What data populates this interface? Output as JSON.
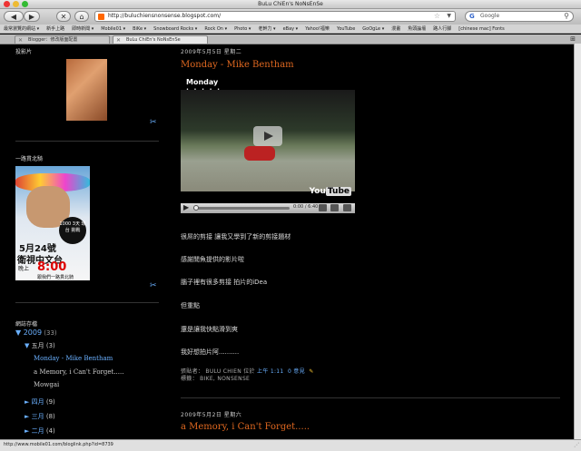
{
  "window": {
    "title": "BuLu ChiEn's NoNsEnSe"
  },
  "nav": {
    "url": "http://buluchiensnonsense.blogspot.com/",
    "search_placeholder": "Google",
    "google_glyph": "G"
  },
  "bookmarks": [
    "最常瀏覽的網站 ▾",
    "新手上路",
    "即時新聞 ▾",
    "Mobile01 ▾",
    "BiKe ▾",
    "Snowboard Rocks ▾",
    "Rock On ▾",
    "Photo ▾",
    "老幹力 ▾",
    "eBay ▾",
    "Yahoo!福樂",
    "YouTube",
    "GoOgLe ▾",
    "漫畫",
    "魚頭論壇",
    "路人行腳",
    "[chinese mac] Fonts"
  ],
  "tabs": [
    {
      "label": "Blogger：修改版面配置",
      "active": false
    },
    {
      "label": "BuLu ChiEn's NoNsEnSe",
      "active": true
    }
  ],
  "sidebar": {
    "photo_heading": "投影片",
    "poster_heading": "一路貫北騎",
    "poster": {
      "badge": "1000 3天 環台 挑戰",
      "date_line": "5月24號",
      "channel": "衛視中文台",
      "time_label": "晚上",
      "time": "8:00",
      "tagline": "跟我們一路貫北騎"
    },
    "archive_heading": "網誌存檔",
    "archive": {
      "year": "2009",
      "year_count": "(33)",
      "month": "五月",
      "month_count": "(3)",
      "posts": [
        "Monday - Mike Bentham",
        "a Memory, i Can't Forget.....",
        "Mowgai"
      ],
      "other_months": [
        {
          "label": "四月",
          "count": "(9)"
        },
        {
          "label": "三月",
          "count": "(8)"
        },
        {
          "label": "二月",
          "count": "(4)"
        }
      ]
    }
  },
  "post1": {
    "date": "2009年5月5日 星期二",
    "title": "Monday - Mike Bentham",
    "video": {
      "title": "Monday",
      "time": "0:00 / 6:40",
      "logo_you": "You",
      "logo_tube": "Tube"
    },
    "paragraphs": [
      "很屌的剪接 讓我又學到了新的剪接題材",
      "感謝閒魚提供的影片啦",
      "腦子裡有很多剪接 拍片的iDea",
      "但重點",
      "還是讓我快點滑到爽",
      "我好想拍片阿.........."
    ],
    "meta_posted": "張貼者： BULU CHIEN 位於",
    "meta_time": "上午 1:11",
    "meta_comments": "0 意見",
    "meta_labels_prefix": "標籤：",
    "meta_labels": "BIKE, NONSENSE"
  },
  "post2": {
    "date": "2009年5月2日 星期六",
    "title": "a Memory, i Can't Forget....."
  },
  "statusbar": {
    "text": "http://www.mobile01.com/bloglink.php?id=8739"
  },
  "colors": {
    "accent": "#e06820",
    "link": "#6ab0ff",
    "background": "#000000"
  },
  "icons": {
    "back": "back-arrow-icon",
    "forward": "forward-arrow-icon",
    "stop": "stop-icon",
    "home": "home-icon",
    "wrench": "wrench-icon",
    "play": "play-icon",
    "pencil": "pencil-icon"
  }
}
